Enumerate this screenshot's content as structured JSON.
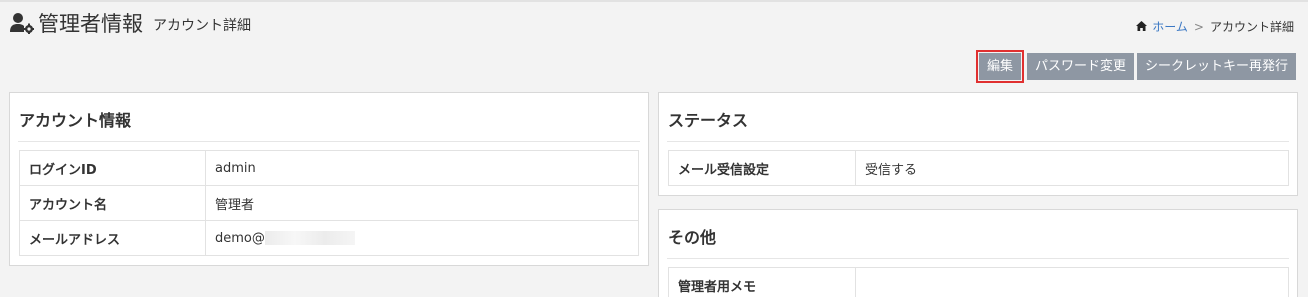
{
  "header": {
    "title": "管理者情報",
    "subtitle": "アカウント詳細",
    "user_icon": "user-gear-icon"
  },
  "breadcrumb": {
    "home_icon": "home-icon",
    "home_label": "ホーム",
    "separator": ">",
    "current": "アカウント詳細"
  },
  "toolbar": {
    "edit_label": "編集",
    "password_label": "パスワード変更",
    "secret_key_label": "シークレットキー再発行",
    "button_color": "#8e97a3",
    "highlight_color": "#e03030"
  },
  "account_panel": {
    "title": "アカウント情報",
    "rows": [
      {
        "label": "ログインID",
        "value": "admin"
      },
      {
        "label": "アカウント名",
        "value": "管理者"
      },
      {
        "label": "メールアドレス",
        "value": "demo@"
      }
    ]
  },
  "status_panel": {
    "title": "ステータス",
    "rows": [
      {
        "label": "メール受信設定",
        "value": "受信する"
      }
    ]
  },
  "other_panel": {
    "title": "その他",
    "rows": [
      {
        "label": "管理者用メモ",
        "value": ""
      }
    ]
  }
}
